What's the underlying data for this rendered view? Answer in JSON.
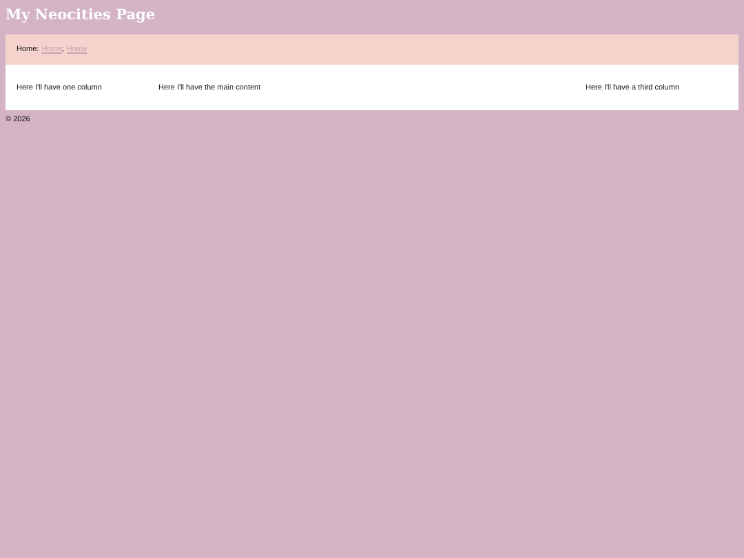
{
  "title": "My Neocities Page",
  "nav": {
    "label": "Home:",
    "links": [
      "Home",
      "Home"
    ],
    "separator": ";"
  },
  "columns": [
    "Here I'll have one column",
    "Here I'll have the main content",
    "Here I'll have a third column"
  ],
  "footer": "© 2026"
}
